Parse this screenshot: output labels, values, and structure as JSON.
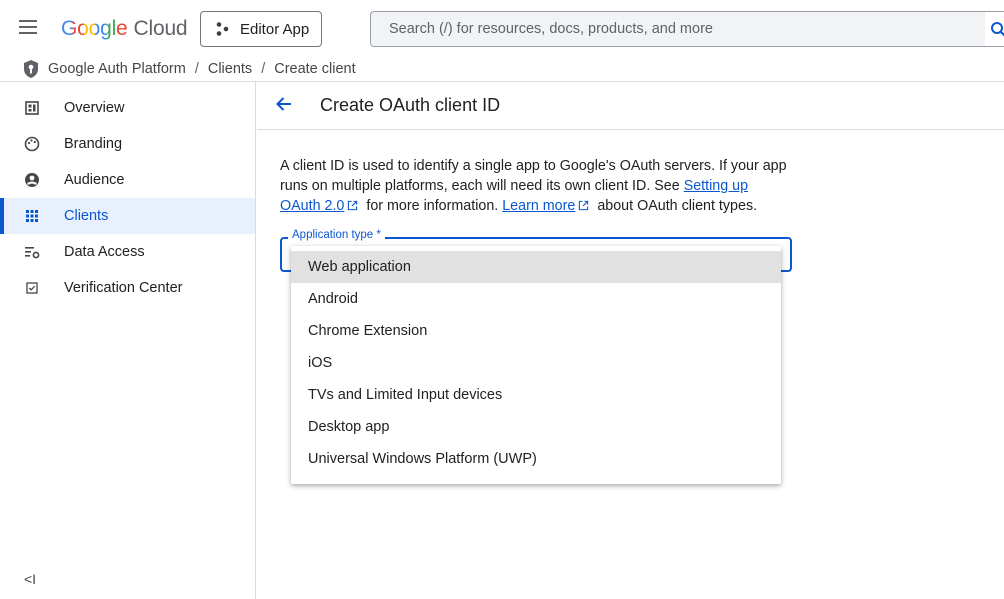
{
  "header": {
    "logo_google": "Google",
    "logo_cloud": "Cloud",
    "project_label": "Editor App",
    "search_placeholder": "Search (/) for resources, docs, products, and more"
  },
  "breadcrumb": {
    "items": [
      "Google Auth Platform",
      "Clients",
      "Create client"
    ],
    "separator": "/"
  },
  "sidebar": {
    "items": [
      {
        "label": "Overview",
        "icon": "dashboard-icon"
      },
      {
        "label": "Branding",
        "icon": "palette-icon"
      },
      {
        "label": "Audience",
        "icon": "account-circle-icon"
      },
      {
        "label": "Clients",
        "icon": "apps-grid-icon",
        "active": true
      },
      {
        "label": "Data Access",
        "icon": "data-settings-icon"
      },
      {
        "label": "Verification Center",
        "icon": "checkbox-icon"
      }
    ],
    "collapse_label": "<I"
  },
  "page": {
    "title": "Create OAuth client ID",
    "desc_part1": "A client ID is used to identify a single app to Google's OAuth servers. If your app runs on multiple platforms, each will need its own client ID. See ",
    "link1": "Setting up OAuth 2.0",
    "desc_part2": " for more information. ",
    "link2": "Learn more",
    "desc_part3": " about OAuth client types.",
    "field_label": "Application type *",
    "options": [
      "Web application",
      "Android",
      "Chrome Extension",
      "iOS",
      "TVs and Limited Input devices",
      "Desktop app",
      "Universal Windows Platform (UWP)"
    ],
    "highlighted_option": "Web application"
  },
  "colors": {
    "accent": "#0b57d0",
    "active_bg": "#e8f0fe",
    "highlight_bg": "#e1e1e1"
  }
}
